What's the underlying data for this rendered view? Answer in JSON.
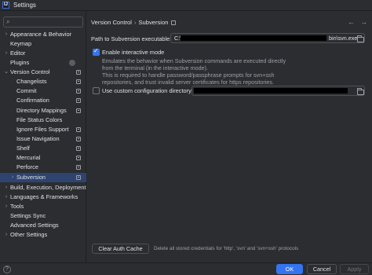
{
  "window": {
    "title": "Settings",
    "app_icon": "IJ"
  },
  "sidebar": {
    "search_icon": "search-icon",
    "items": [
      {
        "label": "Appearance & Behavior",
        "chevron": "›",
        "cfg": false
      },
      {
        "label": "Keymap",
        "chevron": "",
        "cfg": false
      },
      {
        "label": "Editor",
        "chevron": "›",
        "cfg": false
      },
      {
        "label": "Plugins",
        "chevron": "",
        "cfg": false
      },
      {
        "label": "Version Control",
        "chevron": "⌄",
        "cfg": true
      },
      {
        "label": "Changelists",
        "chevron": "",
        "cfg": true
      },
      {
        "label": "Commit",
        "chevron": "",
        "cfg": true
      },
      {
        "label": "Confirmation",
        "chevron": "",
        "cfg": true
      },
      {
        "label": "Directory Mappings",
        "chevron": "",
        "cfg": true
      },
      {
        "label": "File Status Colors",
        "chevron": "",
        "cfg": false
      },
      {
        "label": "Ignore Files Support",
        "chevron": "",
        "cfg": true
      },
      {
        "label": "Issue Navigation",
        "chevron": "",
        "cfg": true
      },
      {
        "label": "Shelf",
        "chevron": "",
        "cfg": true
      },
      {
        "label": "Mercurial",
        "chevron": "",
        "cfg": true
      },
      {
        "label": "Perforce",
        "chevron": "",
        "cfg": true
      },
      {
        "label": "Subversion",
        "chevron": "›",
        "cfg": true,
        "selected": true
      },
      {
        "label": "Build, Execution, Deployment",
        "chevron": "›",
        "cfg": false
      },
      {
        "label": "Languages & Frameworks",
        "chevron": "›",
        "cfg": false
      },
      {
        "label": "Tools",
        "chevron": "›",
        "cfg": false
      },
      {
        "label": "Settings Sync",
        "chevron": "",
        "cfg": false
      },
      {
        "label": "Advanced Settings",
        "chevron": "",
        "cfg": false
      },
      {
        "label": "Other Settings",
        "chevron": "›",
        "cfg": false
      }
    ]
  },
  "breadcrumb": {
    "parent": "Version Control",
    "separator": "›",
    "current": "Subversion"
  },
  "nav": {
    "back": "←",
    "forward": "→"
  },
  "svn_path": {
    "label": "Path to Subversion executable:",
    "prefix": "C:\\",
    "suffix": "bin\\svn.exe"
  },
  "interactive": {
    "label": "Enable interactive mode",
    "checked": true,
    "description": [
      "Emulates the behavior when Subversion commands are executed directly",
      "from the terminal (in the interactive mode).",
      "This is required to handle password/passphrase prompts for svn+ssh",
      "repositories, and trust invalid server certificates for https repositories."
    ]
  },
  "custom_config": {
    "label": "Use custom configuration directory:",
    "checked": false
  },
  "auth": {
    "button": "Clear Auth Cache",
    "hint": "Delete all stored credentials for 'http', 'svn' and 'svn+ssh' protocols"
  },
  "footer": {
    "help": "?",
    "ok": "OK",
    "cancel": "Cancel",
    "apply": "Apply"
  },
  "colors": {
    "accent": "#3574f0",
    "selection": "#2e436e",
    "background": "#2b2d30"
  }
}
